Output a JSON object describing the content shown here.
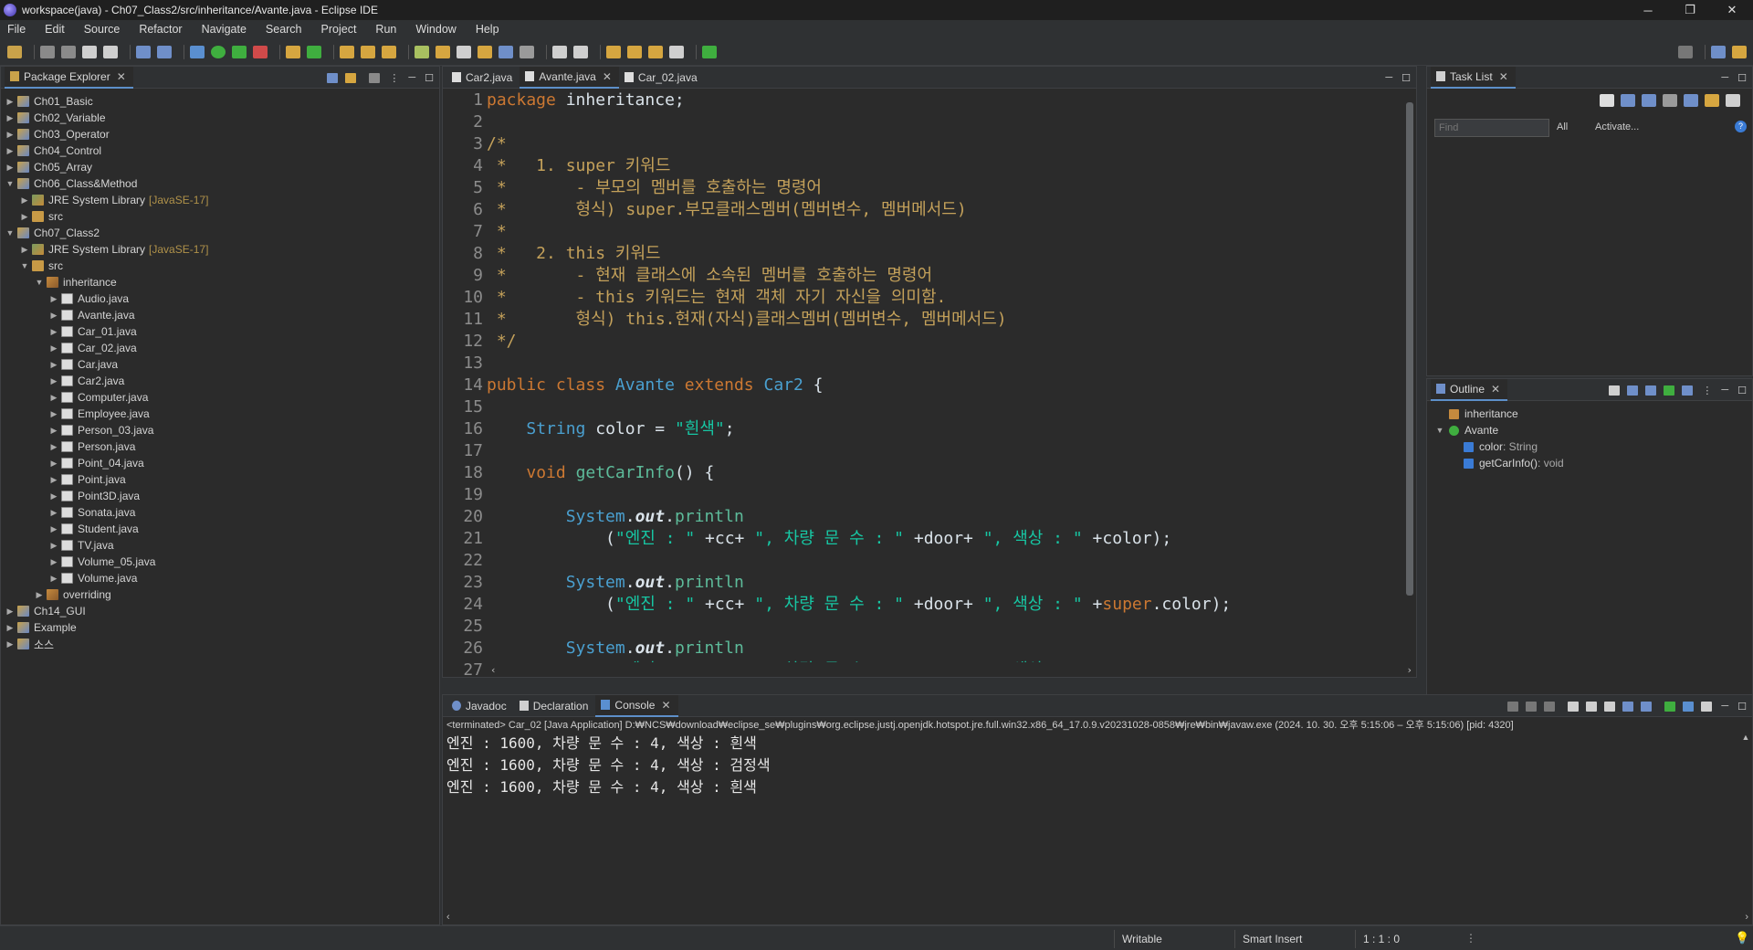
{
  "window": {
    "title": "workspace(java) - Ch07_Class2/src/inheritance/Avante.java - Eclipse IDE",
    "controls": [
      "─",
      "❐",
      "✕"
    ]
  },
  "menu": [
    "File",
    "Edit",
    "Source",
    "Refactor",
    "Navigate",
    "Search",
    "Project",
    "Run",
    "Window",
    "Help"
  ],
  "package_explorer": {
    "tab_label": "Package Explorer",
    "tree": [
      {
        "label": "Ch01_Basic",
        "kind": "project",
        "depth": 0,
        "expanded": false
      },
      {
        "label": "Ch02_Variable",
        "kind": "project",
        "depth": 0,
        "expanded": false
      },
      {
        "label": "Ch03_Operator",
        "kind": "project",
        "depth": 0,
        "expanded": false
      },
      {
        "label": "Ch04_Control",
        "kind": "project",
        "depth": 0,
        "expanded": false
      },
      {
        "label": "Ch05_Array",
        "kind": "project",
        "depth": 0,
        "expanded": false
      },
      {
        "label": "Ch06_Class&Method",
        "kind": "project",
        "depth": 0,
        "expanded": true
      },
      {
        "label": "JRE System Library",
        "kind": "lib",
        "depth": 1,
        "expanded": false,
        "decoration": "[JavaSE-17]"
      },
      {
        "label": "src",
        "kind": "src",
        "depth": 1,
        "expanded": false
      },
      {
        "label": "Ch07_Class2",
        "kind": "project",
        "depth": 0,
        "expanded": true
      },
      {
        "label": "JRE System Library",
        "kind": "lib",
        "depth": 1,
        "expanded": false,
        "decoration": "[JavaSE-17]"
      },
      {
        "label": "src",
        "kind": "src",
        "depth": 1,
        "expanded": true
      },
      {
        "label": "inheritance",
        "kind": "pkg",
        "depth": 2,
        "expanded": true
      },
      {
        "label": "Audio.java",
        "kind": "file",
        "depth": 3,
        "expanded": false
      },
      {
        "label": "Avante.java",
        "kind": "file",
        "depth": 3,
        "expanded": false
      },
      {
        "label": "Car_01.java",
        "kind": "file",
        "depth": 3,
        "expanded": false
      },
      {
        "label": "Car_02.java",
        "kind": "file",
        "depth": 3,
        "expanded": false
      },
      {
        "label": "Car.java",
        "kind": "file",
        "depth": 3,
        "expanded": false
      },
      {
        "label": "Car2.java",
        "kind": "file",
        "depth": 3,
        "expanded": false
      },
      {
        "label": "Computer.java",
        "kind": "file",
        "depth": 3,
        "expanded": false
      },
      {
        "label": "Employee.java",
        "kind": "file",
        "depth": 3,
        "expanded": false
      },
      {
        "label": "Person_03.java",
        "kind": "file",
        "depth": 3,
        "expanded": false
      },
      {
        "label": "Person.java",
        "kind": "file",
        "depth": 3,
        "expanded": false
      },
      {
        "label": "Point_04.java",
        "kind": "file",
        "depth": 3,
        "expanded": false
      },
      {
        "label": "Point.java",
        "kind": "file",
        "depth": 3,
        "expanded": false
      },
      {
        "label": "Point3D.java",
        "kind": "file",
        "depth": 3,
        "expanded": false
      },
      {
        "label": "Sonata.java",
        "kind": "file",
        "depth": 3,
        "expanded": false
      },
      {
        "label": "Student.java",
        "kind": "file",
        "depth": 3,
        "expanded": false
      },
      {
        "label": "TV.java",
        "kind": "file",
        "depth": 3,
        "expanded": false
      },
      {
        "label": "Volume_05.java",
        "kind": "file",
        "depth": 3,
        "expanded": false
      },
      {
        "label": "Volume.java",
        "kind": "file",
        "depth": 3,
        "expanded": false
      },
      {
        "label": "overriding",
        "kind": "pkg",
        "depth": 2,
        "expanded": false
      },
      {
        "label": "Ch14_GUI",
        "kind": "project",
        "depth": 0,
        "expanded": false
      },
      {
        "label": "Example",
        "kind": "project",
        "depth": 0,
        "expanded": false
      },
      {
        "label": "소스",
        "kind": "project",
        "depth": 0,
        "expanded": false
      }
    ]
  },
  "editor": {
    "tabs": [
      {
        "label": "Car2.java",
        "active": false
      },
      {
        "label": "Avante.java",
        "active": true
      },
      {
        "label": "Car_02.java",
        "active": false
      }
    ],
    "lines": [
      [
        {
          "t": "package",
          "c": "kw"
        },
        {
          "t": " inheritance;",
          "c": "fd"
        }
      ],
      [],
      [
        {
          "t": "/*",
          "c": "cm"
        }
      ],
      [
        {
          "t": " *   1. super 키워드",
          "c": "cm"
        }
      ],
      [
        {
          "t": " *       - 부모의 멤버를 호출하는 명령어",
          "c": "cm"
        }
      ],
      [
        {
          "t": " *       형식) super.부모클래스멤버(멤버변수, 멤버메서드)",
          "c": "cm"
        }
      ],
      [
        {
          "t": " *",
          "c": "cm"
        }
      ],
      [
        {
          "t": " *   2. this 키워드",
          "c": "cm"
        }
      ],
      [
        {
          "t": " *       - 현재 클래스에 소속된 멤버를 호출하는 명령어",
          "c": "cm"
        }
      ],
      [
        {
          "t": " *       - this 키워드는 현재 객체 자기 자신을 의미함.",
          "c": "cm"
        }
      ],
      [
        {
          "t": " *       형식) this.현재(자식)클래스멤버(멤버변수, 멤버메서드)",
          "c": "cm"
        }
      ],
      [
        {
          "t": " */",
          "c": "cm"
        }
      ],
      [],
      [
        {
          "t": "public",
          "c": "kw"
        },
        {
          "t": " ",
          "c": "fd"
        },
        {
          "t": "class",
          "c": "kw"
        },
        {
          "t": " ",
          "c": "fd"
        },
        {
          "t": "Avante",
          "c": "ty"
        },
        {
          "t": " ",
          "c": "fd"
        },
        {
          "t": "extends",
          "c": "kw"
        },
        {
          "t": " ",
          "c": "fd"
        },
        {
          "t": "Car2",
          "c": "ty"
        },
        {
          "t": " {",
          "c": "fd"
        }
      ],
      [],
      [
        {
          "t": "    ",
          "c": "fd"
        },
        {
          "t": "String",
          "c": "ty"
        },
        {
          "t": " color = ",
          "c": "fd"
        },
        {
          "t": "\"흰색\"",
          "c": "st"
        },
        {
          "t": ";",
          "c": "fd"
        }
      ],
      [],
      [
        {
          "t": "    ",
          "c": "fd"
        },
        {
          "t": "void",
          "c": "kw"
        },
        {
          "t": " ",
          "c": "fd"
        },
        {
          "t": "getCarInfo",
          "c": "mt"
        },
        {
          "t": "() {",
          "c": "fd"
        }
      ],
      [],
      [
        {
          "t": "        ",
          "c": "fd"
        },
        {
          "t": "System",
          "c": "ty"
        },
        {
          "t": ".",
          "c": "fd"
        },
        {
          "t": "out",
          "c": "fd ital"
        },
        {
          "t": ".",
          "c": "fd"
        },
        {
          "t": "println",
          "c": "mt"
        }
      ],
      [
        {
          "t": "            (",
          "c": "fd"
        },
        {
          "t": "\"엔진 : \"",
          "c": "st"
        },
        {
          "t": " +cc+ ",
          "c": "fd"
        },
        {
          "t": "\", 차량 문 수 : \"",
          "c": "st"
        },
        {
          "t": " +door+ ",
          "c": "fd"
        },
        {
          "t": "\", 색상 : \"",
          "c": "st"
        },
        {
          "t": " +color);",
          "c": "fd"
        }
      ],
      [],
      [
        {
          "t": "        ",
          "c": "fd"
        },
        {
          "t": "System",
          "c": "ty"
        },
        {
          "t": ".",
          "c": "fd"
        },
        {
          "t": "out",
          "c": "fd ital"
        },
        {
          "t": ".",
          "c": "fd"
        },
        {
          "t": "println",
          "c": "mt"
        }
      ],
      [
        {
          "t": "            (",
          "c": "fd"
        },
        {
          "t": "\"엔진 : \"",
          "c": "st"
        },
        {
          "t": " +cc+ ",
          "c": "fd"
        },
        {
          "t": "\", 차량 문 수 : \"",
          "c": "st"
        },
        {
          "t": " +door+ ",
          "c": "fd"
        },
        {
          "t": "\", 색상 : \"",
          "c": "st"
        },
        {
          "t": " +",
          "c": "fd"
        },
        {
          "t": "super",
          "c": "kw"
        },
        {
          "t": ".color);",
          "c": "fd"
        }
      ],
      [],
      [
        {
          "t": "        ",
          "c": "fd"
        },
        {
          "t": "System",
          "c": "ty"
        },
        {
          "t": ".",
          "c": "fd"
        },
        {
          "t": "out",
          "c": "fd ital"
        },
        {
          "t": ".",
          "c": "fd"
        },
        {
          "t": "println",
          "c": "mt"
        }
      ],
      [
        {
          "t": "            (",
          "c": "fd"
        },
        {
          "t": "\"엔진 : \"",
          "c": "st"
        },
        {
          "t": " +cc+ ",
          "c": "fd"
        },
        {
          "t": "\", 차량 문 수 : \"",
          "c": "st"
        },
        {
          "t": " +door+ ",
          "c": "fd"
        },
        {
          "t": "\", 색상 : \"",
          "c": "st"
        },
        {
          "t": " +",
          "c": "fd"
        },
        {
          "t": "this",
          "c": "kw"
        },
        {
          "t": ".color);",
          "c": "fd"
        }
      ]
    ]
  },
  "task_list": {
    "tab_label": "Task List",
    "find_placeholder": "Find",
    "all_label": "All",
    "activate_label": "Activate..."
  },
  "outline": {
    "tab_label": "Outline",
    "items": [
      {
        "label": "inheritance",
        "type": "",
        "depth": 0,
        "kind": "pkg"
      },
      {
        "label": "Avante",
        "type": "",
        "depth": 0,
        "kind": "class"
      },
      {
        "label": "color",
        "type": " : String",
        "depth": 1,
        "kind": "field"
      },
      {
        "label": "getCarInfo()",
        "type": " : void",
        "depth": 1,
        "kind": "method"
      }
    ]
  },
  "bottom": {
    "tabs": [
      {
        "label": "Javadoc",
        "active": false
      },
      {
        "label": "Declaration",
        "active": false
      },
      {
        "label": "Console",
        "active": true
      }
    ],
    "status_line": "<terminated> Car_02 [Java Application] D:₩NCS₩download₩eclipse_se₩plugins₩org.eclipse.justj.openjdk.hotspot.jre.full.win32.x86_64_17.0.9.v20231028-0858₩jre₩bin₩javaw.exe  (2024. 10. 30. 오후 5:15:06 – 오후 5:15:06) [pid: 4320]",
    "output": [
      "엔진 : 1600, 차량 문 수 : 4, 색상 : 흰색",
      "엔진 : 1600, 차량 문 수 : 4, 색상 : 검정색",
      "엔진 : 1600, 차량 문 수 : 4, 색상 : 흰색"
    ]
  },
  "statusbar": {
    "writable": "Writable",
    "insert_mode": "Smart Insert",
    "position": "1 : 1 : 0"
  },
  "colors": {
    "keyword": "#cc7832",
    "comment": "#c4a15a",
    "type": "#4aa0d0",
    "string": "#17c6a3",
    "accent": "#5d8fc9"
  }
}
